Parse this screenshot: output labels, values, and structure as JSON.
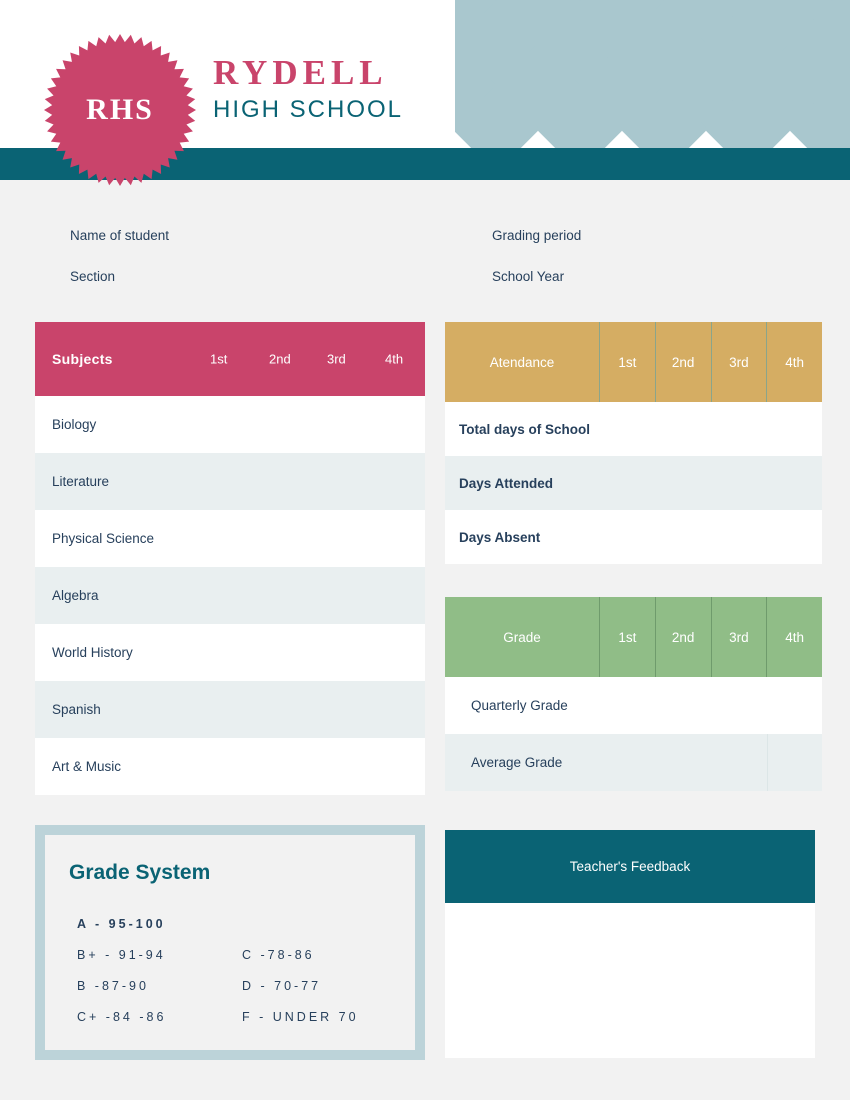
{
  "school": {
    "seal_text": "RHS",
    "name": "RYDELL",
    "subtitle": "HIGH SCHOOL"
  },
  "fields": {
    "name_of_student": "Name of student",
    "section": "Section",
    "grading_period": "Grading period",
    "school_year": "School Year"
  },
  "subjects_table": {
    "header_label": "Subjects",
    "quarters": [
      "1st",
      "2nd",
      "3rd",
      "4th"
    ],
    "rows": [
      "Biology",
      "Literature",
      "Physical Science",
      "Algebra",
      "World History",
      "Spanish",
      "Art & Music"
    ]
  },
  "attendance_table": {
    "header_label": "Atendance",
    "quarters": [
      "1st",
      "2nd",
      "3rd",
      "4th"
    ],
    "rows": [
      "Total days of School",
      "Days Attended",
      "Days Absent"
    ]
  },
  "grade_table": {
    "header_label": "Grade",
    "quarters": [
      "1st",
      "2nd",
      "3rd",
      "4th"
    ],
    "rows": [
      "Quarterly Grade",
      "Average Grade"
    ]
  },
  "grade_system": {
    "title": "Grade System",
    "entries": [
      {
        "left": "A  -  95-100",
        "right": ""
      },
      {
        "left": "B+  -  91-94",
        "right": "C  -78-86"
      },
      {
        "left": "B  -87-90",
        "right": "D  -  70-77"
      },
      {
        "left": "C+  -84  -86",
        "right": "F  -  UNDER 70"
      }
    ]
  },
  "feedback": {
    "title": "Teacher's Feedback",
    "body_text": ""
  },
  "colors": {
    "pink": "#c9446b",
    "teal": "#0a6374",
    "gold": "#d5ad63",
    "green": "#90bd87",
    "light_blue": "#bcd3d9",
    "diamond": "#a9c7ce",
    "row_alt": "#e9eff0",
    "page_bg": "#f2f2f2",
    "text_navy": "#27405c"
  }
}
